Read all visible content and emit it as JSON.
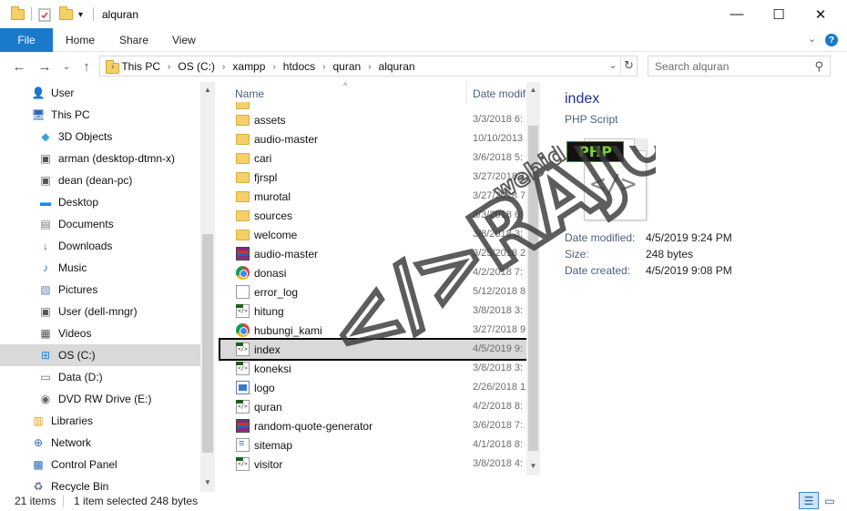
{
  "window": {
    "title": "alquran",
    "controls": {
      "minimize": "—",
      "maximize": "☐",
      "close": "✕"
    }
  },
  "ribbon": {
    "tabs": [
      "File",
      "Home",
      "Share",
      "View"
    ],
    "expand_icon": "chevron-down-icon",
    "help": "?"
  },
  "address": {
    "crumbs": [
      "This PC",
      "OS (C:)",
      "xampp",
      "htdocs",
      "quran",
      "alquran"
    ]
  },
  "search": {
    "placeholder": "Search alquran"
  },
  "nav": {
    "items": [
      {
        "label": "User",
        "icon": "user-icon",
        "selected": false
      },
      {
        "label": "This PC",
        "icon": "computer-icon",
        "selected": false
      },
      {
        "label": "3D Objects",
        "icon": "cube-icon",
        "selected": false
      },
      {
        "label": "arman (desktop-dtmn-x)",
        "icon": "network-drive-icon",
        "selected": false
      },
      {
        "label": "dean (dean-pc)",
        "icon": "network-drive-icon",
        "selected": false
      },
      {
        "label": "Desktop",
        "icon": "desktop-icon",
        "selected": false
      },
      {
        "label": "Documents",
        "icon": "documents-icon",
        "selected": false
      },
      {
        "label": "Downloads",
        "icon": "download-icon",
        "selected": false
      },
      {
        "label": "Music",
        "icon": "music-icon",
        "selected": false
      },
      {
        "label": "Pictures",
        "icon": "pictures-icon",
        "selected": false
      },
      {
        "label": "User (dell-mngr)",
        "icon": "network-drive-icon",
        "selected": false
      },
      {
        "label": "Videos",
        "icon": "videos-icon",
        "selected": false
      },
      {
        "label": "OS (C:)",
        "icon": "windows-drive-icon",
        "selected": true
      },
      {
        "label": "Data (D:)",
        "icon": "drive-icon",
        "selected": false
      },
      {
        "label": "DVD RW Drive (E:)",
        "icon": "dvd-icon",
        "selected": false
      },
      {
        "label": "Libraries",
        "icon": "libraries-icon",
        "selected": false
      },
      {
        "label": "Network",
        "icon": "network-icon",
        "selected": false
      },
      {
        "label": "Control Panel",
        "icon": "control-panel-icon",
        "selected": false
      },
      {
        "label": "Recycle Bin",
        "icon": "recycle-bin-icon",
        "selected": false
      }
    ]
  },
  "files": {
    "columns": {
      "name": "Name",
      "date": "Date modif"
    },
    "rows": [
      {
        "name": "assets",
        "date": "3/3/2018 6:",
        "type": "folder"
      },
      {
        "name": "audio-master",
        "date": "10/10/2013",
        "type": "folder"
      },
      {
        "name": "cari",
        "date": "3/6/2018 5:",
        "type": "folder"
      },
      {
        "name": "fjrspl",
        "date": "3/27/2018 1",
        "type": "folder"
      },
      {
        "name": "murotal",
        "date": "3/27/2018 7",
        "type": "folder"
      },
      {
        "name": "sources",
        "date": "3/3/2018 6:",
        "type": "folder"
      },
      {
        "name": "welcome",
        "date": "3/8/2018 3:",
        "type": "folder"
      },
      {
        "name": "audio-master",
        "date": "3/25/2018 2",
        "type": "rar"
      },
      {
        "name": "donasi",
        "date": "4/2/2018 7:",
        "type": "chrome"
      },
      {
        "name": "error_log",
        "date": "5/12/2018 8",
        "type": "text"
      },
      {
        "name": "hitung",
        "date": "3/8/2018 3:",
        "type": "php"
      },
      {
        "name": "hubungi_kami",
        "date": "3/27/2018 9",
        "type": "chrome"
      },
      {
        "name": "index",
        "date": "4/5/2019 9:",
        "type": "php",
        "selected": true
      },
      {
        "name": "koneksi",
        "date": "3/8/2018 3:",
        "type": "php"
      },
      {
        "name": "logo",
        "date": "2/26/2018 1",
        "type": "image"
      },
      {
        "name": "quran",
        "date": "4/2/2018 8:",
        "type": "php"
      },
      {
        "name": "random-quote-generator",
        "date": "3/6/2018 7:",
        "type": "rar"
      },
      {
        "name": "sitemap",
        "date": "4/1/2018 8:",
        "type": "xml"
      },
      {
        "name": "visitor",
        "date": "3/8/2018 4:",
        "type": "php"
      }
    ]
  },
  "preview": {
    "title": "index",
    "type": "PHP Script",
    "badge": "PHP",
    "glyph": "</>",
    "meta": [
      {
        "label": "Date modified:",
        "value": "4/5/2019 9:24 PM"
      },
      {
        "label": "Size:",
        "value": "248 bytes"
      },
      {
        "label": "Date created:",
        "value": "4/5/2019 9:08 PM"
      }
    ]
  },
  "status": {
    "count": "21 items",
    "selection": "1 item selected  248 bytes"
  },
  "watermark": {
    "text": "</>RAJU",
    "subtext": "webid"
  }
}
